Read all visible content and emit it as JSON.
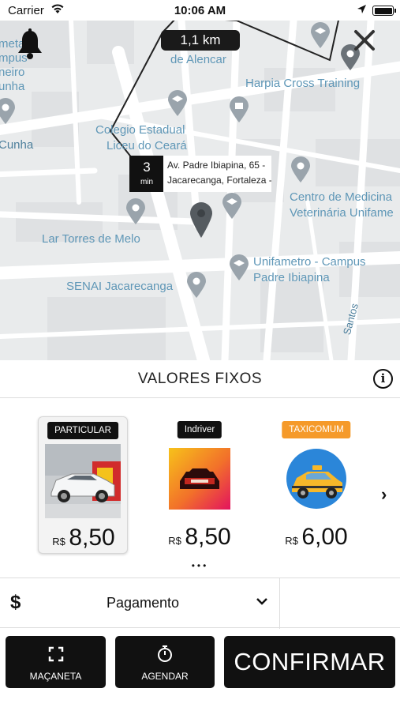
{
  "status_bar": {
    "carrier": "Carrier",
    "time": "10:06 AM"
  },
  "map": {
    "distance": "1,1 km",
    "eta_value": "3",
    "eta_unit": "min",
    "address_line1": "Av. Padre Ibiapina, 65 -",
    "address_line2": "Jacarecanga, Fortaleza -",
    "labels": {
      "alencar": "de Alencar",
      "harpia": "Harpia Cross Training",
      "colegio1": "Colegio Estadual",
      "colegio2": "Liceu do Ceará",
      "centro1": "Centro de Medicina",
      "centro2": "Veterinária Unifame",
      "lar": "Lar Torres de Melo",
      "unifametro1": "Unifametro - Campus",
      "unifametro2": "Padre Ibiapina",
      "senai": "SENAI Jacarecanga",
      "cunha": "Cunha",
      "santos": "Santos",
      "left1": "meta",
      "left2": "mpus",
      "left3": "neiro",
      "left4": "unha"
    }
  },
  "header": {
    "title": "VALORES FIXOS",
    "info_icon": "i"
  },
  "options": [
    {
      "badge": "PARTICULAR",
      "currency": "R$",
      "price": "8,50",
      "selected": true,
      "badge_color": "#111111"
    },
    {
      "badge": "Indriver",
      "currency": "R$",
      "price": "8,50",
      "selected": false,
      "badge_color": "#111111"
    },
    {
      "badge": "TAXICOMUM",
      "currency": "R$",
      "price": "6,00",
      "selected": false,
      "badge_color": "#f59a2a"
    }
  ],
  "pager_dots": "•••",
  "next_arrow": "›",
  "payment": {
    "currency_icon": "$",
    "label": "Pagamento"
  },
  "buttons": {
    "door": "MAÇANETA",
    "schedule": "AGENDAR",
    "confirm": "CONFIRMAR"
  }
}
